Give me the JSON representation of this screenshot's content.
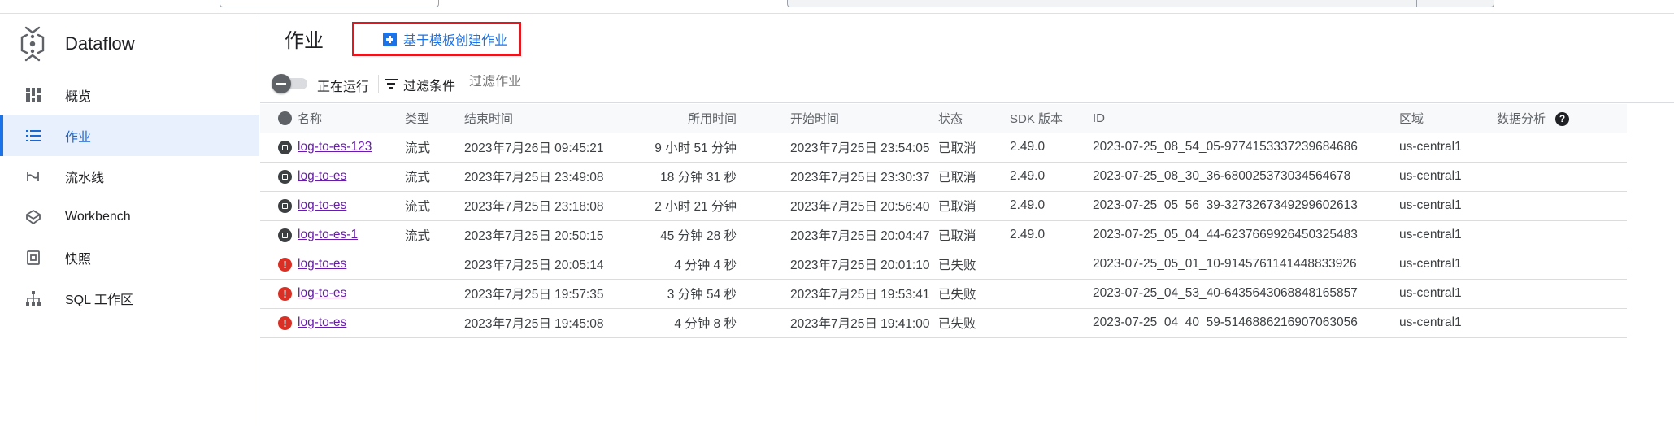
{
  "app": {
    "name": "Dataflow"
  },
  "sidebar": {
    "items": [
      {
        "label": "概览",
        "icon": "dashboard-icon",
        "active": false
      },
      {
        "label": "作业",
        "icon": "list-icon",
        "active": true
      },
      {
        "label": "流水线",
        "icon": "pipeline-icon",
        "active": false
      },
      {
        "label": "Workbench",
        "icon": "workbench-icon",
        "active": false
      },
      {
        "label": "快照",
        "icon": "snapshot-icon",
        "active": false
      },
      {
        "label": "SQL 工作区",
        "icon": "sql-workspace-icon",
        "active": false
      }
    ]
  },
  "header": {
    "title": "作业",
    "create_button": "基于模板创建作业"
  },
  "filterbar": {
    "running_label": "正在运行",
    "filter_label": "过滤条件",
    "filter_placeholder": "过滤作业"
  },
  "table": {
    "columns": {
      "name": "名称",
      "type": "类型",
      "end_time": "结束时间",
      "duration": "所用时间",
      "start_time": "开始时间",
      "status": "状态",
      "sdk": "SDK 版本",
      "id": "ID",
      "region": "区域",
      "analysis": "数据分析"
    },
    "rows": [
      {
        "state": "stopped",
        "name": "log-to-es-123",
        "type": "流式",
        "end_time": "2023年7月26日 09:45:21",
        "duration": "9 小时 51 分钟",
        "start_time": "2023年7月25日 23:54:05",
        "status": "已取消",
        "sdk": "2.49.0",
        "id": "2023-07-25_08_54_05-9774153337239684686",
        "region": "us-central1"
      },
      {
        "state": "stopped",
        "name": "log-to-es",
        "type": "流式",
        "end_time": "2023年7月25日 23:49:08",
        "duration": "18 分钟 31 秒",
        "start_time": "2023年7月25日 23:30:37",
        "status": "已取消",
        "sdk": "2.49.0",
        "id": "2023-07-25_08_30_36-680025373034564678",
        "region": "us-central1"
      },
      {
        "state": "stopped",
        "name": "log-to-es",
        "type": "流式",
        "end_time": "2023年7月25日 23:18:08",
        "duration": "2 小时 21 分钟",
        "start_time": "2023年7月25日 20:56:40",
        "status": "已取消",
        "sdk": "2.49.0",
        "id": "2023-07-25_05_56_39-3273267349299602613",
        "region": "us-central1"
      },
      {
        "state": "stopped",
        "name": "log-to-es-1",
        "type": "流式",
        "end_time": "2023年7月25日 20:50:15",
        "duration": "45 分钟 28 秒",
        "start_time": "2023年7月25日 20:04:47",
        "status": "已取消",
        "sdk": "2.49.0",
        "id": "2023-07-25_05_04_44-6237669926450325483",
        "region": "us-central1"
      },
      {
        "state": "failed",
        "name": "log-to-es",
        "type": "",
        "end_time": "2023年7月25日 20:05:14",
        "duration": "4 分钟 4 秒",
        "start_time": "2023年7月25日 20:01:10",
        "status": "已失败",
        "sdk": "",
        "id": "2023-07-25_05_01_10-9145761141448833926",
        "region": "us-central1"
      },
      {
        "state": "failed",
        "name": "log-to-es",
        "type": "",
        "end_time": "2023年7月25日 19:57:35",
        "duration": "3 分钟 54 秒",
        "start_time": "2023年7月25日 19:53:41",
        "status": "已失败",
        "sdk": "",
        "id": "2023-07-25_04_53_40-6435643068848165857",
        "region": "us-central1"
      },
      {
        "state": "failed",
        "name": "log-to-es",
        "type": "",
        "end_time": "2023年7月25日 19:45:08",
        "duration": "4 分钟 8 秒",
        "start_time": "2023年7月25日 19:41:00",
        "status": "已失败",
        "sdk": "",
        "id": "2023-07-25_04_40_59-5146886216907063056",
        "region": "us-central1"
      }
    ]
  },
  "colors": {
    "accent": "#1a73e8",
    "active_bg": "#e8f0fe",
    "link": "#681da8",
    "error": "#d93025",
    "highlight_border": "#e0181f"
  }
}
